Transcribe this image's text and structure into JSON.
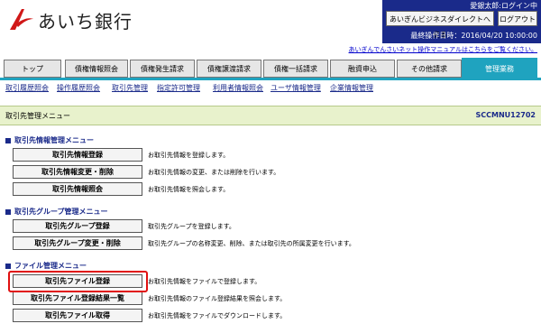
{
  "header": {
    "bank_name": "あいち銀行",
    "user_name": "愛銀太郎:ログイン中",
    "portal_button": "あいぎんビジネスダイレクトへ戻る",
    "logout_button": "ログアウト",
    "last_operation": "最終操作日時：2016/04/20 10:00:00",
    "manual_link": "あいぎんでんさいネット操作マニュアルはこちらをご覧ください。"
  },
  "tabs": [
    {
      "label": "トップ"
    },
    {
      "label": "債権情報照会"
    },
    {
      "label": "債権発生請求"
    },
    {
      "label": "債権譲渡請求"
    },
    {
      "label": "債権一括請求"
    },
    {
      "label": "融資申込"
    },
    {
      "label": "その他請求"
    },
    {
      "label": "管理業務"
    }
  ],
  "subnav": [
    {
      "label": "取引履歴照会"
    },
    {
      "label": "操作履歴照会"
    },
    {
      "label": "取引先管理"
    },
    {
      "label": "指定許可管理"
    },
    {
      "label": "利用者情報照会"
    },
    {
      "label": "ユーザ情報管理"
    },
    {
      "label": "企業情報管理"
    }
  ],
  "page": {
    "title": "取引先管理メニュー",
    "screen_id": "SCCMNU12702"
  },
  "sections": [
    {
      "heading": "取引先情報管理メニュー",
      "items": [
        {
          "button": "取引先情報登録",
          "desc": "お取引先情報を登録します。"
        },
        {
          "button": "取引先情報変更・削除",
          "desc": "お取引先情報の変更、または削除を行います。"
        },
        {
          "button": "取引先情報照会",
          "desc": "お取引先情報を照会します。"
        }
      ]
    },
    {
      "heading": "取引先グループ管理メニュー",
      "items": [
        {
          "button": "取引先グループ登録",
          "desc": "取引先グループを登録します。"
        },
        {
          "button": "取引先グループ変更・削除",
          "desc": "取引先グループの名称変更、削除、または取引先の所属変更を行います。"
        }
      ]
    },
    {
      "heading": "ファイル管理メニュー",
      "items": [
        {
          "button": "取引先ファイル登録",
          "desc": "お取引先情報をファイルで登録します。"
        },
        {
          "button": "取引先ファイル登録結果一覧",
          "desc": "お取引先情報のファイル登録結果を照会します。"
        },
        {
          "button": "取引先ファイル取得",
          "desc": "お取引先情報をファイルでダウンロードします。"
        }
      ]
    }
  ],
  "colors": {
    "brand_navy": "#1a2a8a",
    "active_tab": "#1fa3bf",
    "title_bar": "#e8f2cc",
    "highlight": "#e01010"
  }
}
